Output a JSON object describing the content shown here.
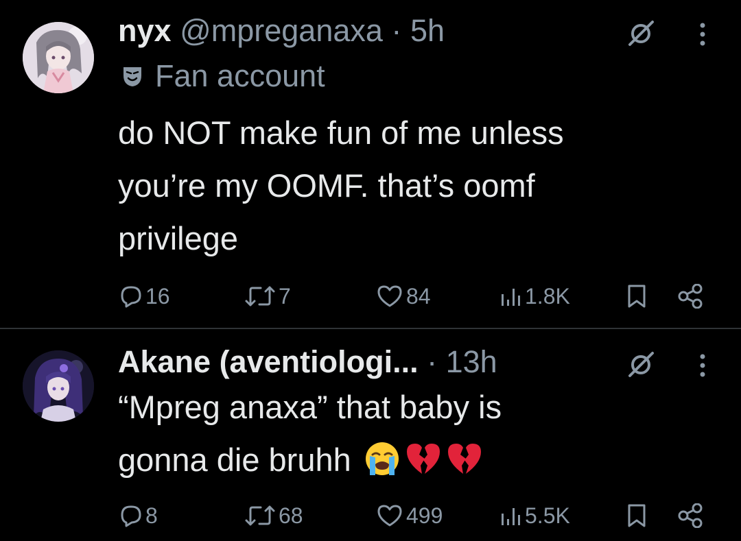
{
  "tweets": [
    {
      "author": {
        "name": "nyx",
        "handle": "@mpreganaxa",
        "dot": "·",
        "time": "5h",
        "label": "Fan account"
      },
      "text_lines": [
        "do NOT make fun of me unless",
        "you’re my OOMF. that’s oomf",
        "privilege"
      ],
      "stats": {
        "replies": "16",
        "reposts": "7",
        "likes": "84",
        "views": "1.8K"
      }
    },
    {
      "author": {
        "name": "Akane (aventiologi...",
        "dot": "·",
        "time": "13h"
      },
      "text_lines": [
        "“Mpreg anaxa” that baby is",
        "gonna die bruhh"
      ],
      "emojis": [
        "loudly-crying-face",
        "broken-heart",
        "broken-heart"
      ],
      "stats": {
        "replies": "8",
        "reposts": "68",
        "likes": "499",
        "views": "5.5K"
      }
    }
  ],
  "colors": {
    "background": "#000000",
    "text": "#e7e9ea",
    "muted": "#8b98a5",
    "divider": "#2f3336"
  },
  "icons": [
    "grok-icon",
    "more-icon",
    "fan-account-mask-icon",
    "reply-icon",
    "repost-icon",
    "like-icon",
    "views-icon",
    "bookmark-icon",
    "share-icon"
  ]
}
